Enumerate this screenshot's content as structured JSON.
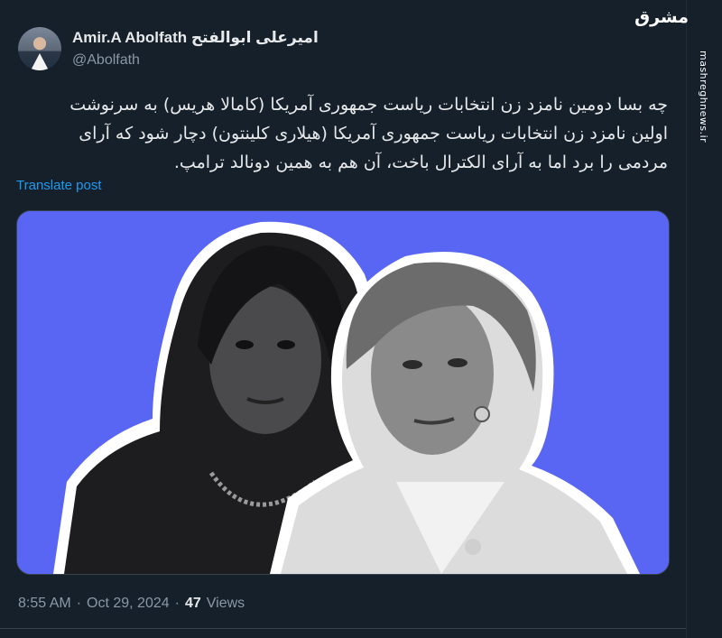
{
  "author": {
    "display_name": "Amir.A Abolfath امیرعلی ابوالفتح",
    "handle": "@Abolfath"
  },
  "tweet": {
    "lines": [
      "چه بسا دومین نامزد زن انتخابات ریاست جمهوری آمریکا (کامالا هریس) به سرنوشت",
      "اولین نامزد زن انتخابات ریاست جمهوری آمریکا (هیلاری کلینتون)  دچار شود که آرای",
      "مردمی را برد اما به آرای الکترال باخت، آن هم به همین دونالد ترامپ."
    ],
    "translate_label": "Translate post"
  },
  "meta": {
    "time": "8:55 AM",
    "separator": "·",
    "date": "Oct 29, 2024",
    "views_count": "47",
    "views_label": "Views"
  },
  "watermark": {
    "logo_text": "مشرق",
    "site": "mashreghnews.ir"
  },
  "colors": {
    "background": "#15202b",
    "media_background": "#5966f3",
    "link": "#1d9bf0",
    "muted": "#8b98a5"
  }
}
